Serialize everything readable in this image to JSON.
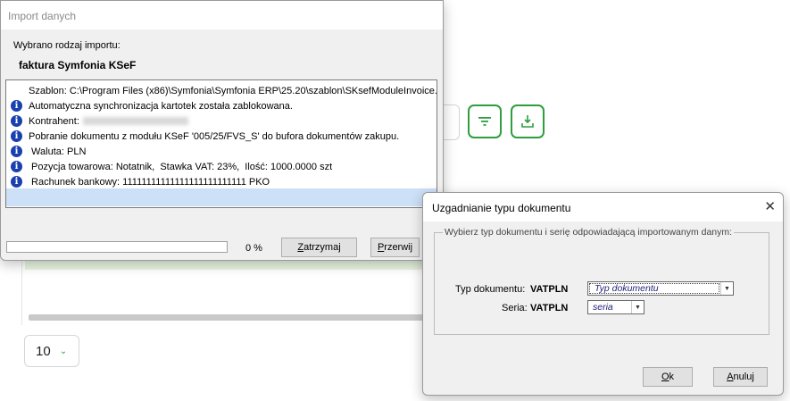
{
  "background": {
    "page_size_value": "10"
  },
  "import_dialog": {
    "title": "Import danych",
    "import_type_label": "Wybrano rodzaj importu:",
    "import_type_value": "faktura Symfonia KSeF",
    "log": [
      {
        "icon": false,
        "text": "Szablon: C:\\Program Files (x86)\\Symfonia\\Symfonia ERP\\25.20\\szablon\\SKsefModuleInvoice..."
      },
      {
        "icon": true,
        "text": "Automatyczna synchronizacja kartotek została zablokowana."
      },
      {
        "icon": true,
        "text": "Kontrahent:"
      },
      {
        "icon": true,
        "text": "Pobranie dokumentu z modułu KSeF '005/25/FVS_S' do bufora dokumentów zakupu."
      },
      {
        "icon": true,
        "text": " Waluta: PLN"
      },
      {
        "icon": true,
        "text": " Pozycja towarowa: Notatnik,  Stawka VAT: 23%,  Ilość: 1000.0000 szt"
      },
      {
        "icon": true,
        "text": " Rachunek bankowy: 11111111111111111111111111 PKO"
      }
    ],
    "progress_percent": 0,
    "progress_text": "0 %",
    "stop_button": {
      "underline": "Z",
      "rest": "atrzymaj"
    },
    "break_button": {
      "underline": "P",
      "rest": "rzerwij"
    }
  },
  "match_dialog": {
    "title": "Uzgadnianie typu dokumentu",
    "close_glyph": "✕",
    "group_label": "Wybierz typ dokumentu i serię odpowiadającą importowanym danym:",
    "doc_type_label": "Typ dokumentu:",
    "doc_type_code": "VATPLN",
    "doc_type_value": "Typ dokumentu",
    "series_label": "Seria:",
    "series_code": "VATPLN",
    "series_value": "seria",
    "ok_button": {
      "underline": "O",
      "rest": "k"
    },
    "cancel_button": {
      "underline": "A",
      "rest": "nuluj"
    }
  },
  "colors": {
    "accent_green": "#2e9e3e",
    "info_icon_blue": "#1a3fae",
    "selection": "#cce0f7"
  },
  "icons": {
    "filter": "filter-icon",
    "download": "download-icon",
    "info": "info-icon"
  }
}
